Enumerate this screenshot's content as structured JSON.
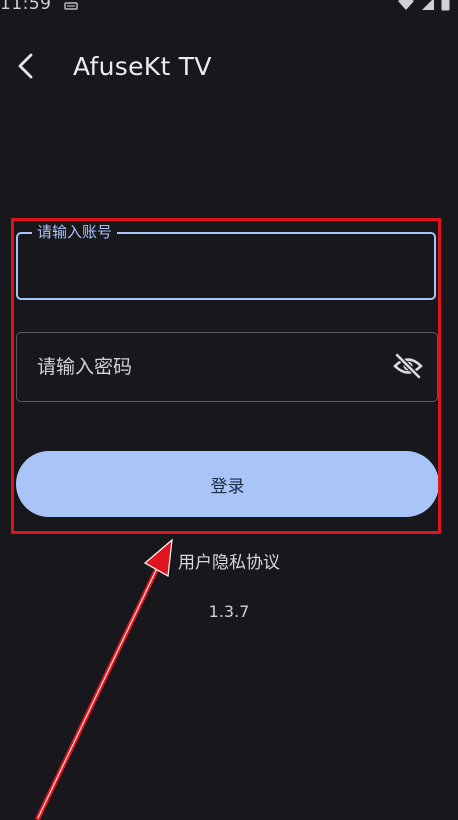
{
  "status_bar": {
    "time": "11:59",
    "left_icon": "sim-icon",
    "right_icons": [
      "wifi-icon",
      "signal-icon",
      "battery-icon"
    ]
  },
  "app_bar": {
    "back_icon": "back-arrow-icon",
    "title": "AfuseKt TV"
  },
  "form": {
    "account": {
      "label": "请输入账号",
      "value": ""
    },
    "password": {
      "placeholder": "请输入密码",
      "value": "",
      "toggle_icon": "eye-off-icon"
    },
    "login_label": "登录"
  },
  "footer": {
    "privacy_link": "用户隐私协议",
    "version": "1.3.7"
  },
  "colors": {
    "background": "#17171c",
    "accent": "#a9c4f7",
    "annotation": "#e0141c"
  }
}
